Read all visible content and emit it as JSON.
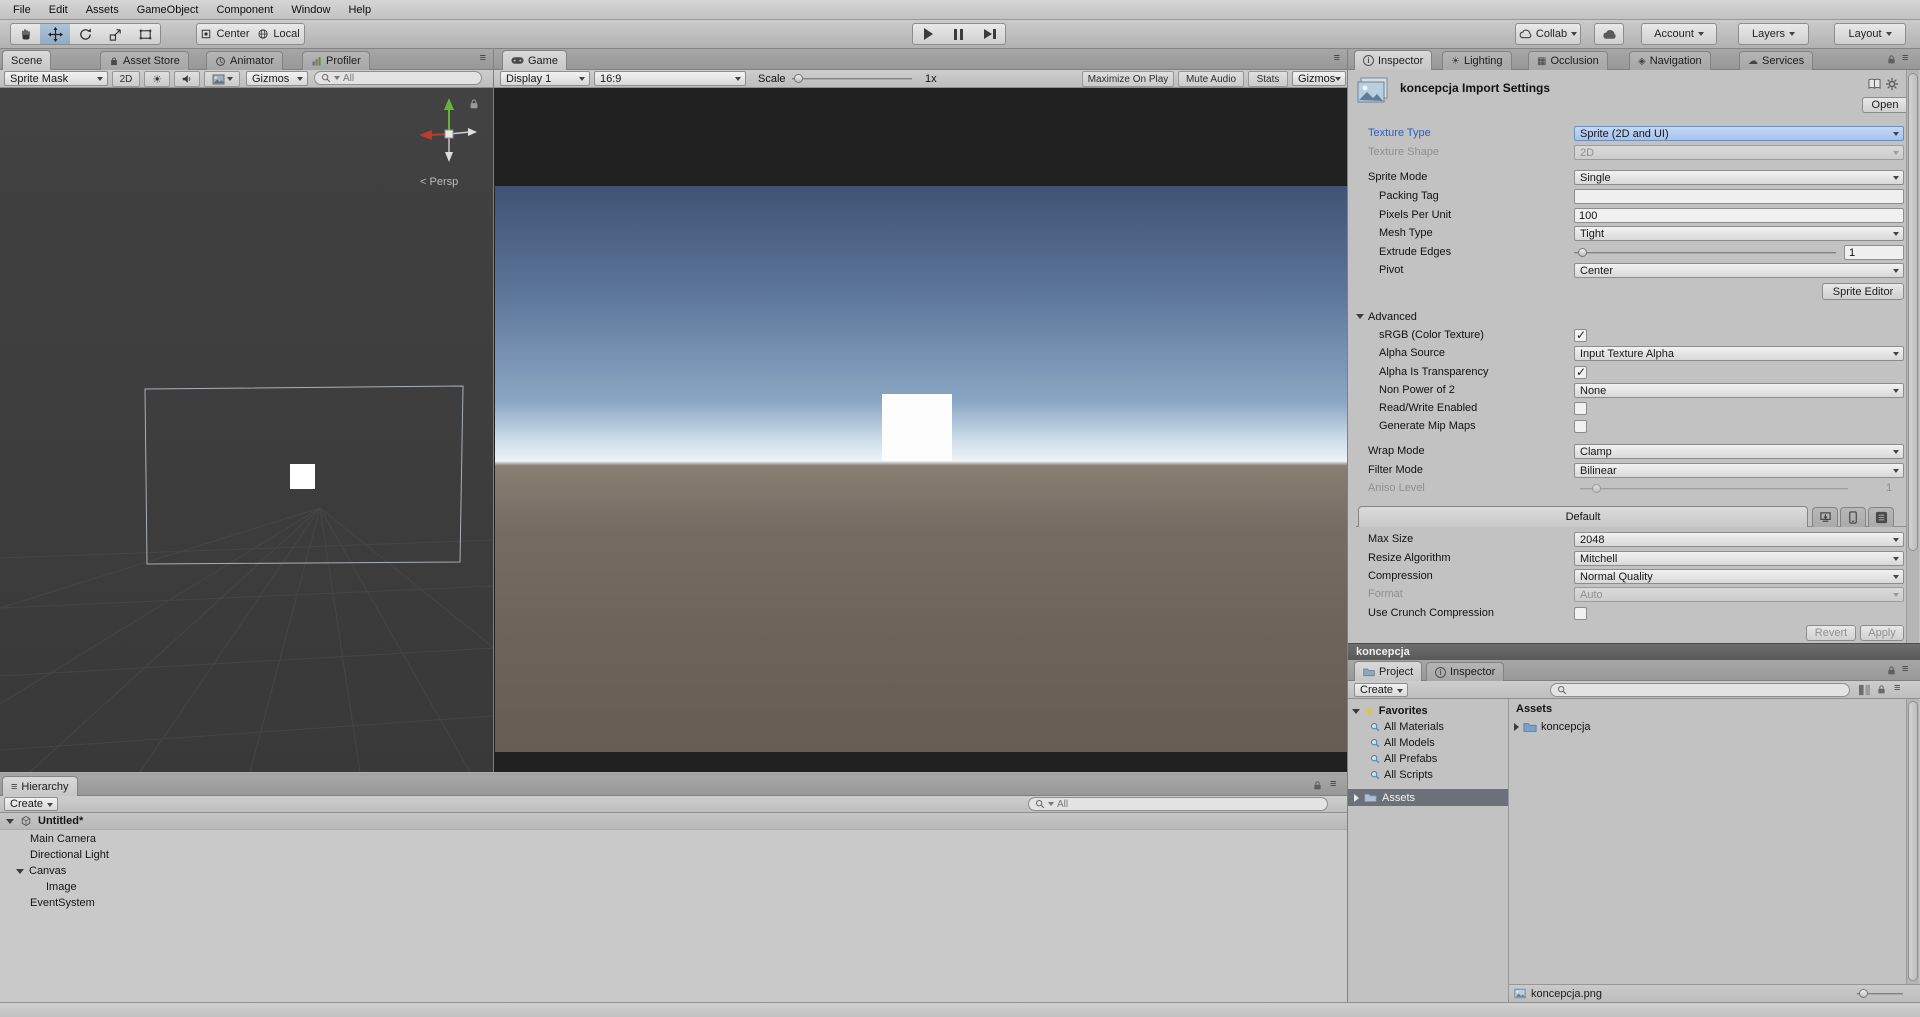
{
  "menu": {
    "items": [
      "File",
      "Edit",
      "Assets",
      "GameObject",
      "Component",
      "Window",
      "Help"
    ]
  },
  "toolbar": {
    "center": "Center",
    "local": "Local",
    "collab": "Collab",
    "account": "Account",
    "layers": "Layers",
    "layout": "Layout"
  },
  "scene": {
    "tabs": [
      "Scene",
      "Asset Store",
      "Animator",
      "Profiler"
    ],
    "mode": "Sprite Mask",
    "toggle_2d": "2D",
    "gizmos": "Gizmos",
    "search": "All",
    "persp": "Persp"
  },
  "game": {
    "tab": "Game",
    "display": "Display 1",
    "aspect": "16:9",
    "scale_label": "Scale",
    "scale_value": "1x",
    "maximize": "Maximize On Play",
    "mute": "Mute Audio",
    "stats": "Stats",
    "gizmos": "Gizmos"
  },
  "hierarchy": {
    "tab": "Hierarchy",
    "create": "Create",
    "search": "All",
    "scene_name": "Untitled*",
    "items": [
      "Main Camera",
      "Directional Light",
      "Canvas",
      "Image",
      "EventSystem"
    ]
  },
  "inspector": {
    "tabs": [
      "Inspector",
      "Lighting",
      "Occlusion",
      "Navigation",
      "Services"
    ],
    "title": "koncepcja Import Settings",
    "open": "Open",
    "texture_type": {
      "label": "Texture Type",
      "value": "Sprite (2D and UI)"
    },
    "texture_shape": {
      "label": "Texture Shape",
      "value": "2D"
    },
    "sprite_mode": {
      "label": "Sprite Mode",
      "value": "Single"
    },
    "packing_tag": {
      "label": "Packing Tag",
      "value": ""
    },
    "pixels_per_unit": {
      "label": "Pixels Per Unit",
      "value": "100"
    },
    "mesh_type": {
      "label": "Mesh Type",
      "value": "Tight"
    },
    "extrude_edges": {
      "label": "Extrude Edges",
      "value": "1"
    },
    "pivot": {
      "label": "Pivot",
      "value": "Center"
    },
    "sprite_editor": "Sprite Editor",
    "advanced": "Advanced",
    "srgb": {
      "label": "sRGB (Color Texture)",
      "checked": true
    },
    "alpha_source": {
      "label": "Alpha Source",
      "value": "Input Texture Alpha"
    },
    "alpha_is_transparency": {
      "label": "Alpha Is Transparency",
      "checked": true
    },
    "non_power_of_2": {
      "label": "Non Power of 2",
      "value": "None"
    },
    "read_write": {
      "label": "Read/Write Enabled",
      "checked": false
    },
    "mip_maps": {
      "label": "Generate Mip Maps",
      "checked": false
    },
    "wrap_mode": {
      "label": "Wrap Mode",
      "value": "Clamp"
    },
    "filter_mode": {
      "label": "Filter Mode",
      "value": "Bilinear"
    },
    "aniso_level": {
      "label": "Aniso Level",
      "value": "1"
    },
    "platform_tab": "Default",
    "max_size": {
      "label": "Max Size",
      "value": "2048"
    },
    "resize_algorithm": {
      "label": "Resize Algorithm",
      "value": "Mitchell"
    },
    "compression": {
      "label": "Compression",
      "value": "Normal Quality"
    },
    "format": {
      "label": "Format",
      "value": "Auto"
    },
    "crunch": {
      "label": "Use Crunch Compression",
      "checked": false
    },
    "revert": "Revert",
    "apply": "Apply",
    "asset_bar": "koncepcja"
  },
  "project": {
    "tabs": [
      "Project",
      "Inspector"
    ],
    "create": "Create",
    "favorites": {
      "label": "Favorites",
      "items": [
        "All Materials",
        "All Models",
        "All Prefabs",
        "All Scripts"
      ]
    },
    "assets_tree": "Assets",
    "assets_header": "Assets",
    "folder": "koncepcja",
    "selected_file": "koncepcja.png"
  },
  "colors": {
    "axis_x": "#c0392b",
    "axis_y": "#67b33a",
    "folder": "#7ba0c8",
    "selection_row": "#6c7078"
  }
}
